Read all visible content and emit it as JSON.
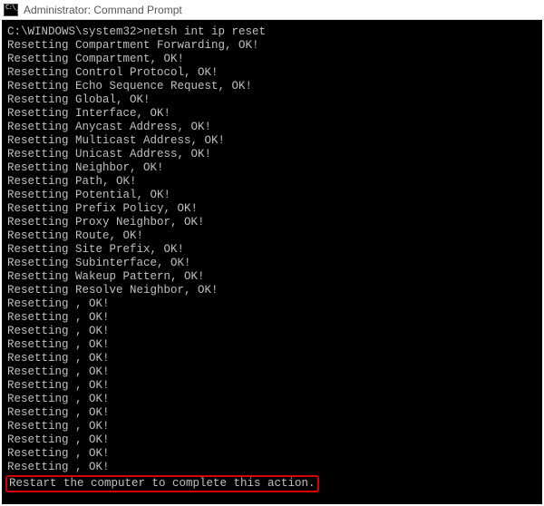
{
  "window": {
    "title": "Administrator: Command Prompt"
  },
  "terminal": {
    "prompt": "C:\\WINDOWS\\system32>",
    "command": "netsh int ip reset",
    "lines": [
      "Resetting Compartment Forwarding, OK!",
      "Resetting Compartment, OK!",
      "Resetting Control Protocol, OK!",
      "Resetting Echo Sequence Request, OK!",
      "Resetting Global, OK!",
      "Resetting Interface, OK!",
      "Resetting Anycast Address, OK!",
      "Resetting Multicast Address, OK!",
      "Resetting Unicast Address, OK!",
      "Resetting Neighbor, OK!",
      "Resetting Path, OK!",
      "Resetting Potential, OK!",
      "Resetting Prefix Policy, OK!",
      "Resetting Proxy Neighbor, OK!",
      "Resetting Route, OK!",
      "Resetting Site Prefix, OK!",
      "Resetting Subinterface, OK!",
      "Resetting Wakeup Pattern, OK!",
      "Resetting Resolve Neighbor, OK!",
      "Resetting , OK!",
      "Resetting , OK!",
      "Resetting , OK!",
      "Resetting , OK!",
      "Resetting , OK!",
      "Resetting , OK!",
      "Resetting , OK!",
      "Resetting , OK!",
      "Resetting , OK!",
      "Resetting , OK!",
      "Resetting , OK!",
      "Resetting , OK!",
      "Resetting , OK!"
    ],
    "restart_message": "Restart the computer to complete this action."
  }
}
